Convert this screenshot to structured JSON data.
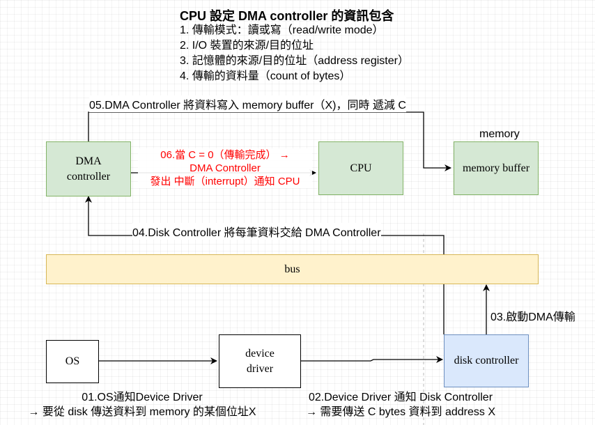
{
  "title": "CPU 設定 DMA controller 的資訊包含",
  "setup_items": [
    "1. 傳輸模式：讀或寫（read/write mode）",
    "2. I/O 裝置的來源/目的位址",
    "3. 記憶體的來源/目的位址（address register）",
    "4. 傳輸的資料量（count of bytes）"
  ],
  "nodes": {
    "dma": "DMA\ncontroller",
    "cpu": "CPU",
    "memory_buffer": "memory buffer",
    "memory_label": "memory",
    "bus": "bus",
    "os": "OS",
    "device_driver": "device\ndriver",
    "disk_controller": "disk controller"
  },
  "edge_labels": {
    "step05": "05.DMA Controller 將資料寫入 memory buffer（X)，同時 遞減 C",
    "step06_line1": "06.當 C = 0（傳輸完成） →",
    "step06_line2": "DMA Controller",
    "step06_line3": "發出 中斷（interrupt）通知 CPU",
    "step04": "04.Disk Controller 將每筆資料交給 DMA Controller",
    "step03": "03.啟動DMA傳輸",
    "step01_line1": "01.OS通知Device Driver",
    "step01_line2": "→ 要從 disk 傳送資料到 memory 的某個位址X",
    "step02_line1": "02.Device Driver 通知 Disk Controller",
    "step02_line2": "→ 需要傳送 C bytes 資料到 address X"
  },
  "colors": {
    "green_fill": "#d5e8d4",
    "green_stroke": "#82b366",
    "yellow_fill": "#fff2cc",
    "yellow_stroke": "#d6b656",
    "blue_fill": "#dae8fc",
    "blue_stroke": "#6c8ebf",
    "red_text": "#ff0000"
  }
}
